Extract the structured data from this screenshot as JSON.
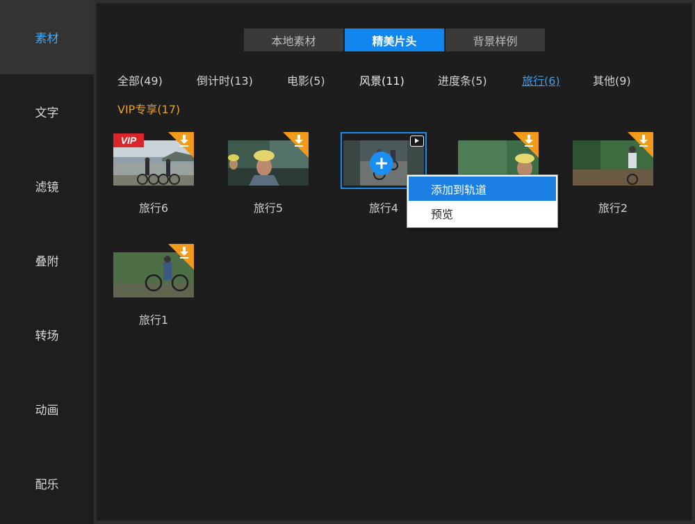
{
  "sidebar": {
    "items": [
      {
        "label": "素材",
        "active": true
      },
      {
        "label": "文字"
      },
      {
        "label": "滤镜"
      },
      {
        "label": "叠附"
      },
      {
        "label": "转场"
      },
      {
        "label": "动画"
      },
      {
        "label": "配乐"
      }
    ]
  },
  "top_tabs": [
    {
      "label": "本地素材"
    },
    {
      "label": "精美片头",
      "active": true
    },
    {
      "label": "背景样例"
    }
  ],
  "categories": [
    {
      "label": "全部(49)"
    },
    {
      "label": "倒计时(13)"
    },
    {
      "label": "电影(5)"
    },
    {
      "label": "风景(11)"
    },
    {
      "label": "进度条(5)"
    },
    {
      "label": "旅行(6)",
      "active": true
    },
    {
      "label": "其他(9)"
    },
    {
      "label": "VIP专享(17)",
      "vip": true
    }
  ],
  "items": [
    {
      "label": "旅行6",
      "vip_badge": "VIP",
      "download_icon": "download-icon"
    },
    {
      "label": "旅行5",
      "download_icon": "download-icon"
    },
    {
      "label": "旅行4",
      "selected": true,
      "overlay_icon": "plus-icon",
      "preview_icon": "play-preview-icon"
    },
    {
      "label": "",
      "download_icon": "download-icon"
    },
    {
      "label": "旅行2",
      "download_icon": "download-icon"
    },
    {
      "label": "旅行1",
      "download_icon": "download-icon"
    }
  ],
  "context_menu": {
    "items": [
      {
        "label": "添加到轨道",
        "highlighted": true
      },
      {
        "label": "预览"
      }
    ]
  },
  "colors": {
    "accent": "#1186ee",
    "vip": "#e8a32a",
    "badge_orange": "#f29a1a",
    "vip_red": "#d9262a"
  }
}
